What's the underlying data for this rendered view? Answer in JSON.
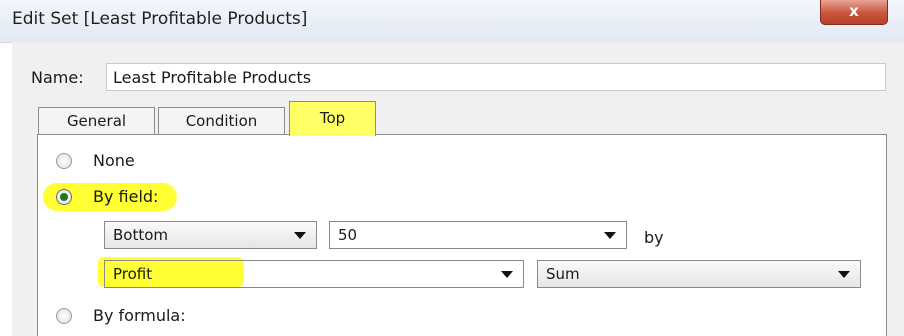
{
  "window": {
    "title": "Edit Set [Least Profitable Products]",
    "close_symbol": "x"
  },
  "name_field": {
    "label": "Name:",
    "value": "Least Profitable Products"
  },
  "tabs": [
    {
      "label": "General"
    },
    {
      "label": "Condition"
    },
    {
      "label": "Top",
      "active": true
    }
  ],
  "top_tab": {
    "options": {
      "none": {
        "label": "None",
        "checked": false
      },
      "by_field": {
        "label": "By field:",
        "checked": true
      },
      "by_formula": {
        "label": "By formula:",
        "checked": false
      }
    },
    "direction": {
      "value": "Bottom"
    },
    "count": {
      "value": "50"
    },
    "by_label": "by",
    "field": {
      "value": "Profit"
    },
    "aggregation": {
      "value": "Sum"
    }
  },
  "colors": {
    "highlight": "#ffff33",
    "close_button": "#c8553c",
    "radio_checked": "#1b7b1b"
  }
}
